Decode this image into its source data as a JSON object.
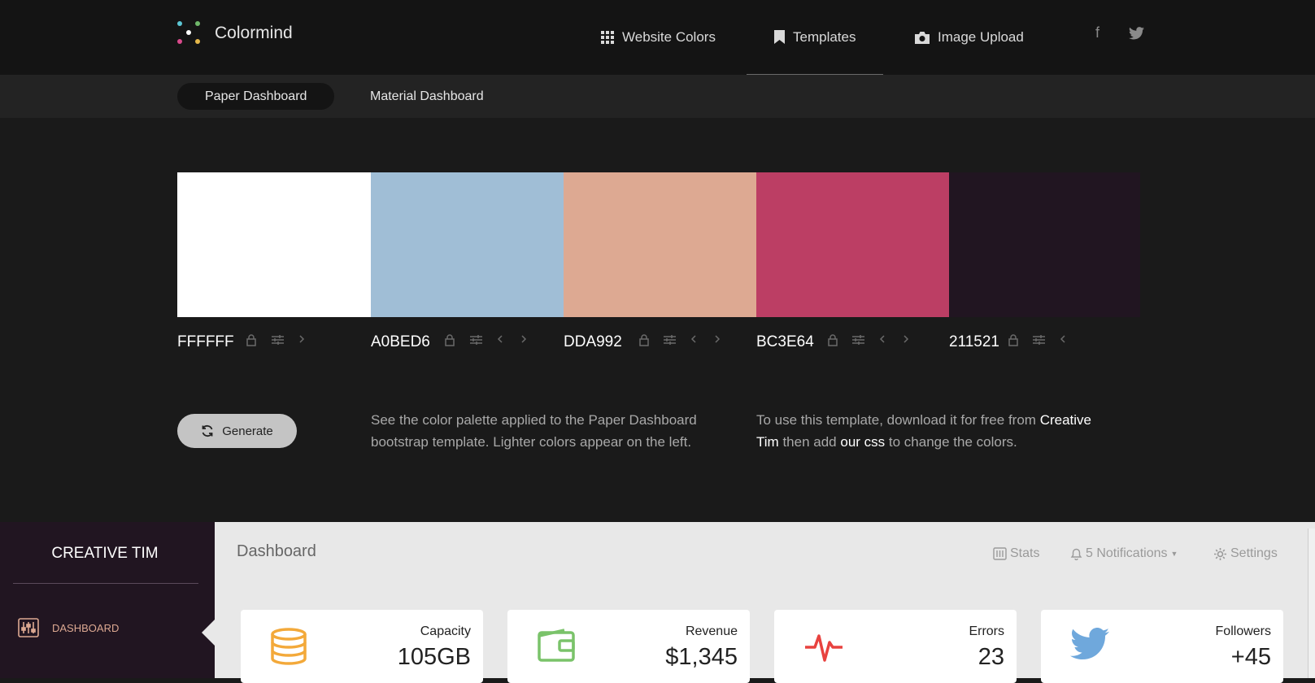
{
  "app": {
    "name": "Colormind"
  },
  "nav": {
    "website_colors": "Website Colors",
    "templates": "Templates",
    "image_upload": "Image Upload",
    "facebook": "f",
    "twitter": "twitter-icon"
  },
  "subnav": {
    "paper": "Paper Dashboard",
    "material": "Material Dashboard"
  },
  "palette": [
    {
      "hex": "FFFFFF",
      "color": "#FFFFFF"
    },
    {
      "hex": "A0BED6",
      "color": "#A0BED6"
    },
    {
      "hex": "DDA992",
      "color": "#DDA992"
    },
    {
      "hex": "BC3E64",
      "color": "#BC3E64"
    },
    {
      "hex": "211521",
      "color": "#211521"
    }
  ],
  "generate": {
    "label": "Generate"
  },
  "desc": {
    "left": "See the color palette applied to the Paper Dashboard bootstrap template. Lighter colors appear on the left.",
    "right_1": "To use this template, download it for free from",
    "creative_tim": "Creative Tim",
    "right_2": "then add",
    "our_css": "our css",
    "right_3": "to change the colors."
  },
  "dashboard": {
    "brand": "CREATIVE TIM",
    "menu_item": "DASHBOARD",
    "title": "Dashboard",
    "stats": "Stats",
    "notifications": "5 Notifications",
    "settings": "Settings",
    "cards": [
      {
        "label": "Capacity",
        "value": "105GB",
        "icon": "database-icon",
        "color": "#f3a93a"
      },
      {
        "label": "Revenue",
        "value": "$1,345",
        "icon": "wallet-icon",
        "color": "#7ac36a"
      },
      {
        "label": "Errors",
        "value": "23",
        "icon": "pulse-icon",
        "color": "#e8423f"
      },
      {
        "label": "Followers",
        "value": "+45",
        "icon": "twitter-icon",
        "color": "#6fa8dc"
      }
    ]
  }
}
